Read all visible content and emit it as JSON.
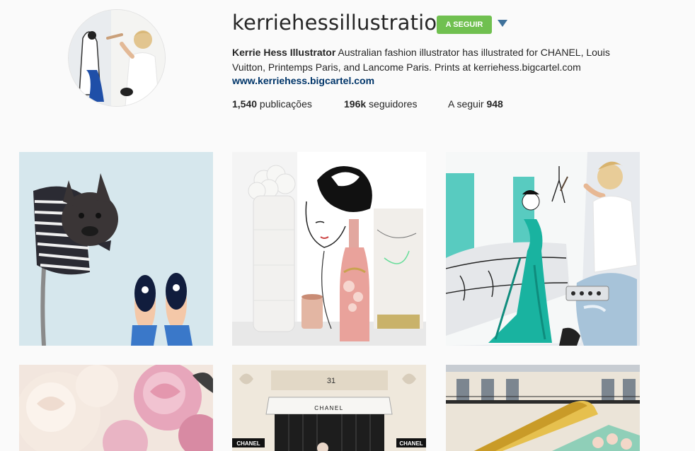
{
  "profile": {
    "username": "kerriehessillustration",
    "follow_button_label": "A SEGUIR",
    "full_name": "Kerrie Hess Illustrator",
    "bio_text": " Australian fashion illustrator has illustrated for CHANEL, Louis Vuitton, Printemps Paris, and Lancome Paris. Prints at kerriehess.bigcartel.com",
    "website": "www.kerriehess.bigcartel.com"
  },
  "stats": {
    "posts_count": "1,540",
    "posts_label": " publicações",
    "followers_count": "196k",
    "followers_label": " seguidores",
    "following_label": "A seguir ",
    "following_count": "948"
  },
  "posts": {
    "p5_address_number": "31",
    "p5_awning_text": "CHANEL",
    "p5_sign_left": "CHANEL",
    "p5_sign_right": "CHANEL"
  },
  "colors": {
    "follow_green": "#70c050",
    "link_blue": "#003569",
    "dropdown_blue": "#3f729b",
    "background": "#fafafa"
  }
}
